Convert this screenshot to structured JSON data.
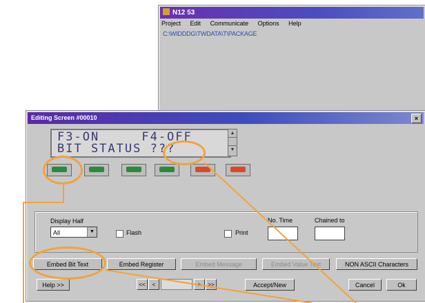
{
  "main_window": {
    "title": "N12 53",
    "menu": [
      "Project",
      "Edit",
      "Communicate",
      "Options",
      "Help"
    ],
    "path": "C:\\WIDDDG\\TWDATA\\T\\PACKAGE"
  },
  "dialog": {
    "title": "Editing Screen #00010",
    "close_label": "×",
    "lcd_line1": "F3-ON     F4-OFF",
    "lcd_line2": "BIT STATUS ???",
    "led_colors": [
      "green",
      "green",
      "green",
      "green",
      "red",
      "red"
    ],
    "display_label": "Display Half",
    "display_value": "All",
    "flash_label": "Flash",
    "print_label": "Print",
    "time_label": "No. Time",
    "chained_label": "Chained to",
    "embed_bit_label": "Embed Bit Text",
    "embed_register_label": "Embed Register",
    "disabled_btn1": "Embed Message",
    "disabled_btn2": "Embed Value Text",
    "non_ascii_label": "NON ASCII Characters",
    "help_label": "Help >>",
    "nav_prev_prev": "<<",
    "nav_prev": "<",
    "nav_next": ">",
    "nav_next_next": ">>",
    "accept_label": "Accept/New",
    "cancel_label": "Cancel",
    "ok_label": "Ok"
  },
  "colors": {
    "highlight": "#f2a23a",
    "led_green": "#2a8a3a",
    "led_red": "#d84a2a"
  }
}
